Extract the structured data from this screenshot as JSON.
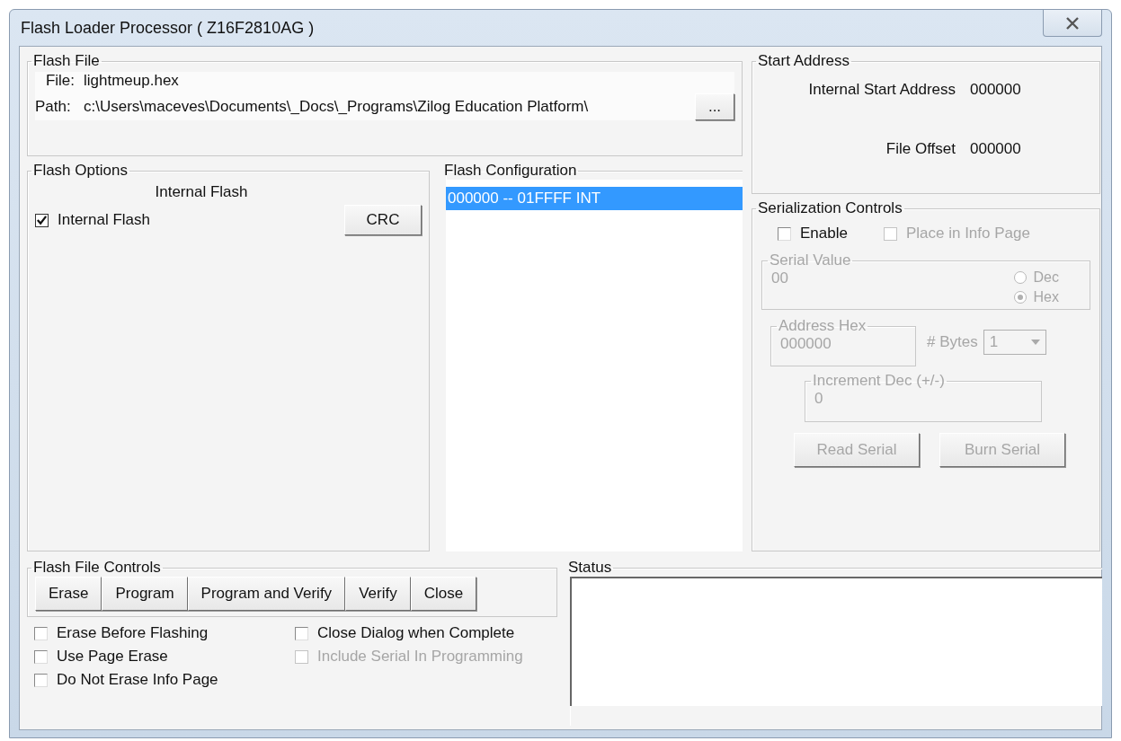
{
  "window": {
    "title": "Flash Loader Processor ( Z16F2810AG )"
  },
  "flash_file": {
    "title": "Flash File",
    "file_label": "File:",
    "file_value": "lightmeup.hex",
    "path_label": "Path:",
    "path_value": "c:\\Users\\maceves\\Documents\\_Docs\\_Programs\\Zilog Education Platform\\",
    "browse_button": "..."
  },
  "flash_options": {
    "title": "Flash Options",
    "subtitle": "Internal Flash",
    "checkbox": {
      "label": "Internal Flash",
      "checked": true
    },
    "crc_button": "CRC"
  },
  "flash_configuration": {
    "title": "Flash Configuration",
    "items": [
      {
        "label": "000000 -- 01FFFF INT",
        "selected": true
      }
    ]
  },
  "start_address": {
    "title": "Start Address",
    "rows": [
      {
        "label": "Internal Start Address",
        "value": "000000"
      },
      {
        "label": "File Offset",
        "value": "000000"
      }
    ]
  },
  "serialization": {
    "title": "Serialization Controls",
    "checkboxes": [
      {
        "label": "Enable",
        "checked": false,
        "disabled": false
      },
      {
        "label": "Place in Info Page",
        "checked": false,
        "disabled": true
      }
    ],
    "serial_value": {
      "title": "Serial Value",
      "value": "00",
      "radios": [
        {
          "label": "Dec",
          "selected": false
        },
        {
          "label": "Hex",
          "selected": true
        }
      ]
    },
    "address_hex": {
      "title": "Address Hex",
      "value": "000000"
    },
    "bytes": {
      "label": "# Bytes",
      "value": "1"
    },
    "increment": {
      "title": "Increment Dec (+/-)",
      "value": "0"
    },
    "buttons": [
      {
        "label": "Read Serial",
        "disabled": true
      },
      {
        "label": "Burn Serial",
        "disabled": true
      }
    ]
  },
  "flash_file_controls": {
    "title": "Flash File Controls",
    "buttons": [
      "Erase",
      "Program",
      "Program and Verify",
      "Verify",
      "Close"
    ]
  },
  "options": [
    {
      "label": "Erase Before Flashing",
      "checked": false,
      "disabled": false
    },
    {
      "label": "Close Dialog when Complete",
      "checked": false,
      "disabled": false
    },
    {
      "label": "Use Page Erase",
      "checked": false,
      "disabled": false
    },
    {
      "label": "Include Serial In Programming",
      "checked": false,
      "disabled": true
    },
    {
      "label": "Do Not Erase Info Page",
      "checked": false,
      "disabled": false
    }
  ],
  "status": {
    "title": "Status"
  }
}
